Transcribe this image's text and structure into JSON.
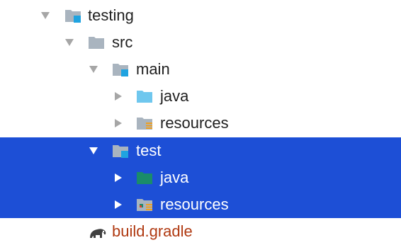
{
  "colors": {
    "selection": "#1d4fd6",
    "arrow": "#a6a6a6",
    "folder_gray": "#a9b4bf",
    "module_badge": "#1fa3e0",
    "source_blue": "#6fc7ee",
    "test_source_green": "#1a8c6a",
    "resources_bars": "#f0a020",
    "gradle_text": "#b03a12"
  },
  "tree": {
    "nodes": [
      {
        "label": "testing",
        "state": "expanded",
        "icon": "module-folder-icon",
        "selected": false
      },
      {
        "label": "src",
        "state": "expanded",
        "icon": "folder-icon",
        "selected": false
      },
      {
        "label": "main",
        "state": "expanded",
        "icon": "module-folder-icon",
        "selected": false
      },
      {
        "label": "java",
        "state": "collapsed",
        "icon": "source-folder-icon",
        "selected": false
      },
      {
        "label": "resources",
        "state": "collapsed",
        "icon": "resources-folder-icon",
        "selected": false
      },
      {
        "label": "test",
        "state": "expanded",
        "icon": "module-folder-icon",
        "selected": true
      },
      {
        "label": "java",
        "state": "collapsed",
        "icon": "test-source-folder-icon",
        "selected": true
      },
      {
        "label": "resources",
        "state": "collapsed",
        "icon": "test-resources-folder-icon",
        "selected": true
      },
      {
        "label": "build.gradle",
        "state": "leaf",
        "icon": "gradle-elephant-icon",
        "selected": false
      }
    ]
  }
}
